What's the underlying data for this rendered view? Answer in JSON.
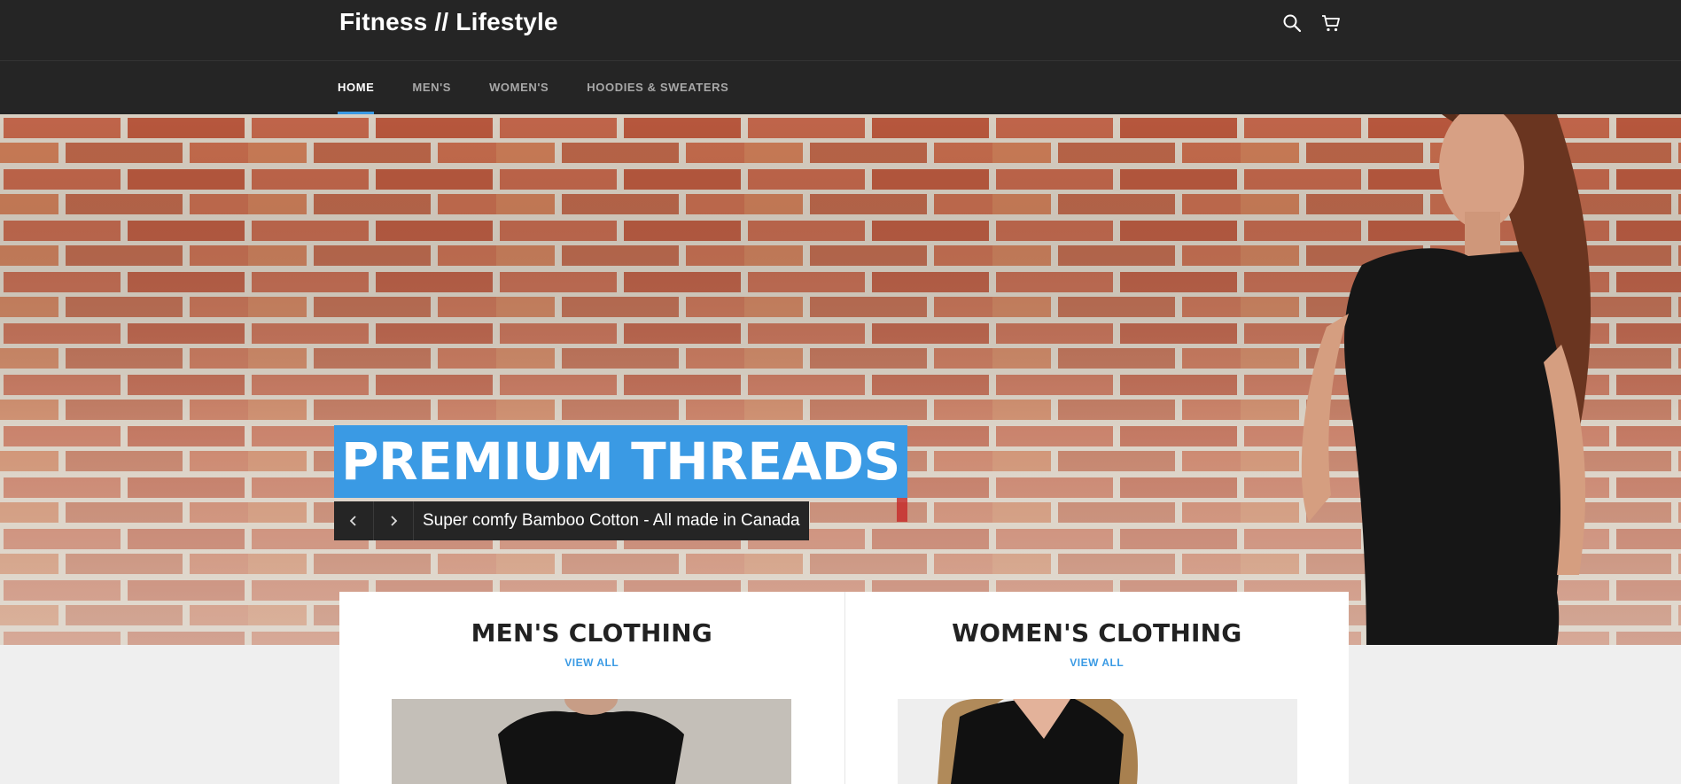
{
  "header": {
    "brand": "Fitness // Lifestyle",
    "icons": [
      "search-icon",
      "cart-icon"
    ]
  },
  "nav": {
    "items": [
      {
        "label": "HOME",
        "active": true
      },
      {
        "label": "MEN'S",
        "active": false
      },
      {
        "label": "WOMEN'S",
        "active": false
      },
      {
        "label": "HOODIES & SWEATERS",
        "active": false
      }
    ]
  },
  "hero": {
    "title": "PREMIUM THREADS",
    "caption": "Super comfy Bamboo Cotton - All made in Canada",
    "prev_icon": "chevron-left-icon",
    "next_icon": "chevron-right-icon"
  },
  "collections": [
    {
      "title": "MEN'S CLOTHING",
      "link": "VIEW ALL"
    },
    {
      "title": "WOMEN'S CLOTHING",
      "link": "VIEW ALL"
    }
  ],
  "colors": {
    "accent": "#3a9ae4",
    "header_bg": "#252525",
    "page_bg": "#efefef"
  }
}
